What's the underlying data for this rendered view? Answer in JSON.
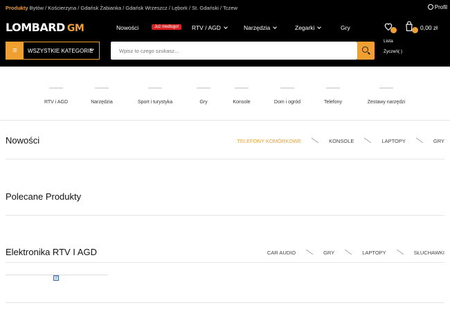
{
  "topbar": {
    "lead": "Produkty",
    "locations": "Bytów / Kościerzyna / Gdańsk Żabianka / Gdańsk Wrzeszcz / Lębork / St. Gdański / Tczew",
    "profile_label": "Profil"
  },
  "logo": {
    "text": "LOMBARD",
    "suffix": "GM"
  },
  "nav": {
    "items": [
      {
        "label": "Nowości"
      },
      {
        "label": "RTV / AGD"
      },
      {
        "label": "Narzędzia"
      },
      {
        "label": "Zegarki"
      },
      {
        "label": "Gry"
      }
    ],
    "promo_badge": "Już niedługo!",
    "wishlist_label": "Lista Życzeń( )",
    "cart_total": "0,00 zł"
  },
  "category_button": {
    "label": "WSZYSTKIE KATEGORIE"
  },
  "search": {
    "placeholder": "Wpisz to czego szukasz..."
  },
  "categories": [
    {
      "name": "RTV i AGD"
    },
    {
      "name": "Narzędzia"
    },
    {
      "name": "Sport i turystyka"
    },
    {
      "name": "Gry"
    },
    {
      "name": "Konsole"
    },
    {
      "name": "Dom i ogród"
    },
    {
      "name": "Telefony"
    },
    {
      "name": "Zestawy narzędzi"
    }
  ],
  "sections": {
    "new": {
      "title": "Nowości",
      "tabs": [
        "TELEFONY KOMÓRKOWE",
        "KONSOLE",
        "LAPTOPY",
        "GRY"
      ]
    },
    "featured": {
      "title": "Polecane Produkty"
    },
    "electronics": {
      "title": "Elektronika RTV I AGD",
      "tabs": [
        "CAR AUDIO",
        "GRY",
        "LAPTOPY",
        "SŁUCHAWKI"
      ]
    }
  },
  "colors": {
    "accent": "#f0a030",
    "promo": "#e02020",
    "bar": "#000000"
  }
}
